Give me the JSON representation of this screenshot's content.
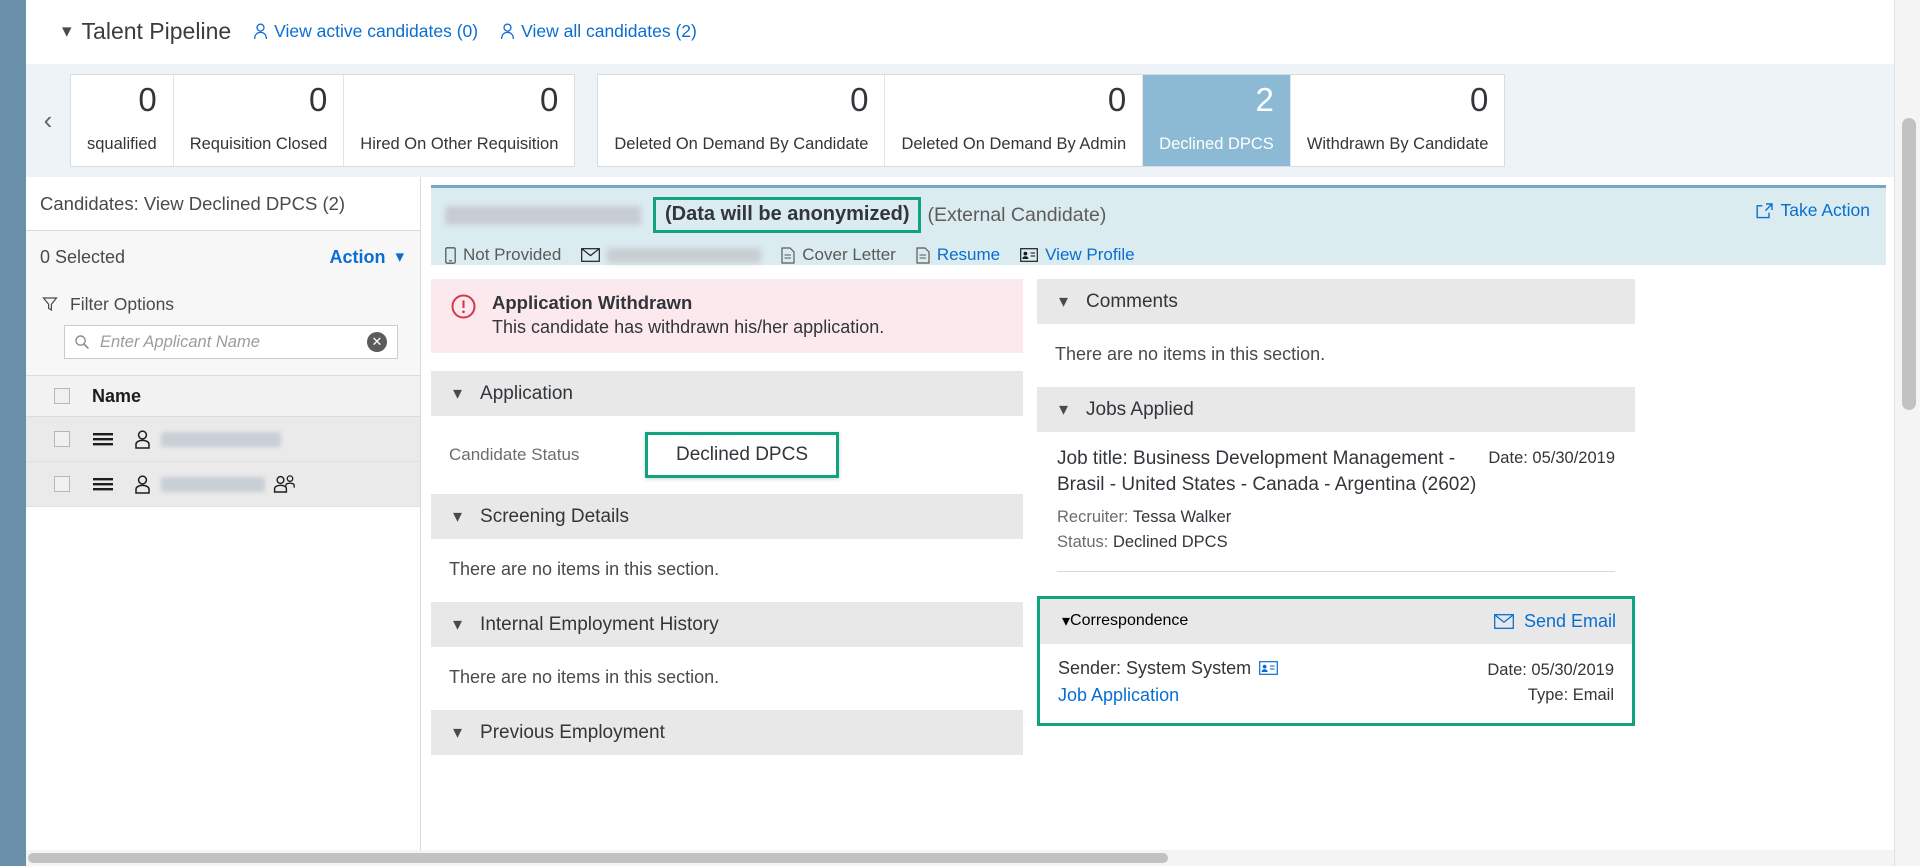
{
  "pipeline": {
    "title": "Talent Pipeline",
    "collapse_icon": "chevron-down-icon",
    "links": [
      {
        "label": "View active candidates (0)",
        "icon": "person-icon"
      },
      {
        "label": "View all candidates (2)",
        "icon": "person-icon"
      }
    ]
  },
  "tiles": {
    "prev_arrow": "chevron-left-icon",
    "group_one": [
      {
        "count": "0",
        "label": "squalified",
        "selected": false,
        "clipped": true
      },
      {
        "count": "0",
        "label": "Requisition Closed",
        "selected": false
      },
      {
        "count": "0",
        "label": "Hired On Other Requisition",
        "selected": false
      }
    ],
    "group_two": [
      {
        "count": "0",
        "label": "Deleted On Demand By Candidate",
        "selected": false
      },
      {
        "count": "0",
        "label": "Deleted On Demand By Admin",
        "selected": false
      },
      {
        "count": "2",
        "label": "Declined DPCS",
        "selected": true
      },
      {
        "count": "0",
        "label": "Withdrawn By Candidate",
        "selected": false
      }
    ]
  },
  "sidebar": {
    "title": "Candidates: View Declined DPCS (2)",
    "selected_text": "0 Selected",
    "action_label": "Action",
    "action_chevron": "chevron-down-icon",
    "filter_label": "Filter Options",
    "filter_icon": "funnel-icon",
    "search": {
      "placeholder": "Enter Applicant Name",
      "value": "",
      "icon": "search-icon",
      "clear_icon": "clear-circle-icon"
    },
    "column_header": "Name",
    "rows": [
      {
        "name_redacted": true,
        "name_width": 120,
        "has_group_icon": false
      },
      {
        "name_redacted": true,
        "name_width": 104,
        "has_group_icon": true
      }
    ]
  },
  "detail": {
    "header": {
      "name_redacted": true,
      "anonymized_note": "(Data will be anonymized)",
      "candidate_type": "(External Candidate)",
      "phone_label": "Not Provided",
      "phone_icon": "mobile-icon",
      "email_icon": "envelope-icon",
      "email_redacted": true,
      "cover_letter": "Cover Letter",
      "cover_letter_icon": "document-icon",
      "resume": "Resume",
      "resume_icon": "document-icon",
      "view_profile": "View Profile",
      "view_profile_icon": "contact-card-icon",
      "take_action": "Take Action",
      "take_action_icon": "external-link-icon"
    },
    "alert": {
      "icon": "error-circle-icon",
      "title": "Application Withdrawn",
      "message": "This candidate has withdrawn his/her application."
    },
    "left_sections": [
      {
        "title": "Application",
        "chevron": "chevron-down-icon"
      },
      {
        "title": "Screening Details",
        "chevron": "chevron-down-icon"
      },
      {
        "title": "Internal Employment History",
        "chevron": "chevron-down-icon"
      },
      {
        "title": "Previous Employment",
        "chevron": "chevron-down-icon"
      }
    ],
    "candidate_status": {
      "label": "Candidate Status",
      "value": "Declined DPCS"
    },
    "empty_text": "There are no items in this section.",
    "right": {
      "comments": {
        "title": "Comments",
        "chevron": "chevron-down-icon",
        "empty": "There are no items in this section."
      },
      "jobs_applied": {
        "title": "Jobs Applied",
        "chevron": "chevron-down-icon",
        "job_title": "Job title: Business Development Management - Brasil - United States - Canada - Argentina (2602)",
        "date": "Date: 05/30/2019",
        "recruiter_key": "Recruiter:",
        "recruiter_value": "Tessa Walker",
        "status_key": "Status:",
        "status_value": "Declined DPCS"
      },
      "correspondence": {
        "title": "Correspondence",
        "chevron": "chevron-down-icon",
        "send_email": "Send Email",
        "send_email_icon": "envelope-icon",
        "sender": "Sender: System System",
        "sender_icon": "contact-card-icon",
        "link": "Job Application",
        "date": "Date: 05/30/2019",
        "type": "Type: Email"
      }
    }
  },
  "colors": {
    "accent_blue": "#0a6ed1",
    "selected_tile": "#8cbad4",
    "highlight_green": "#11a37f",
    "alert_pink": "#fbe9ed",
    "header_teal": "#dbecf0",
    "rail_blue": "#6a8fa8"
  }
}
